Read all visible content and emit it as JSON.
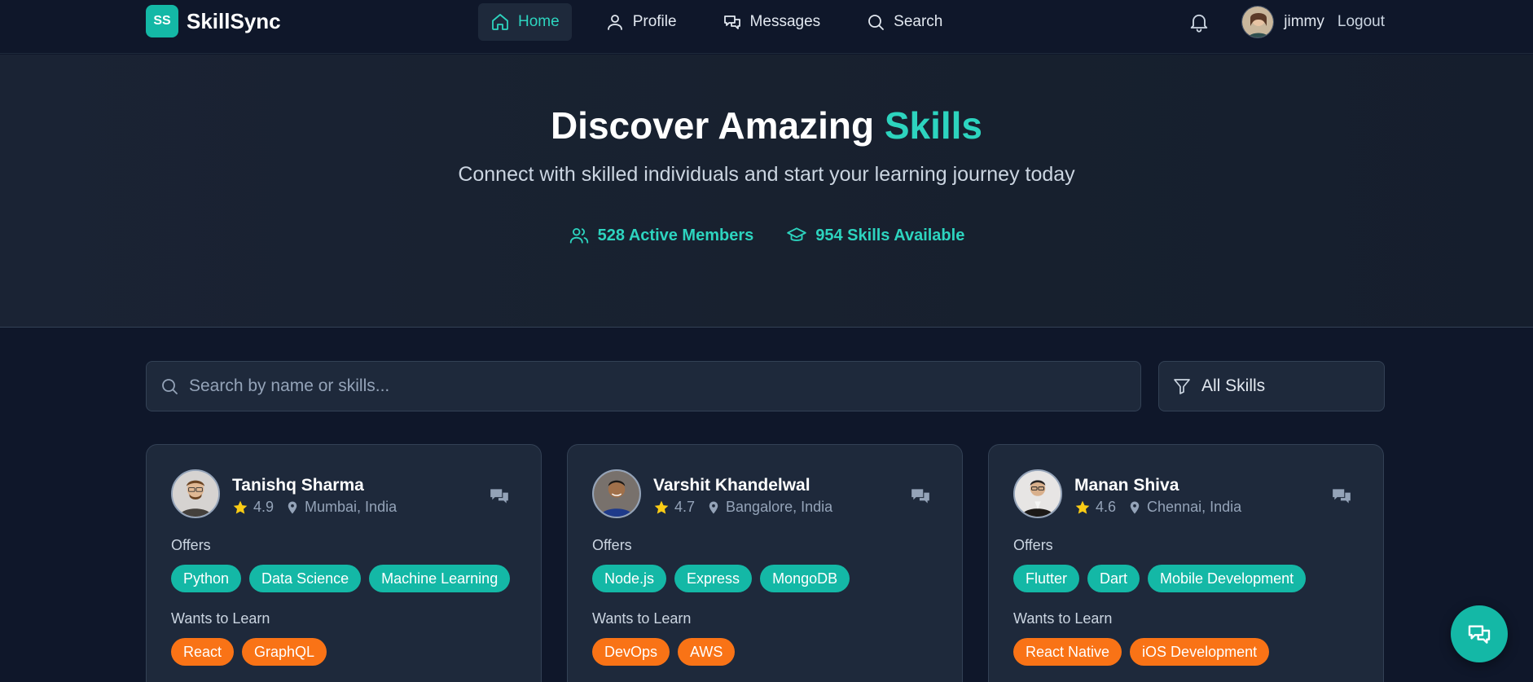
{
  "brand": {
    "logo": "SS",
    "name": "SkillSync"
  },
  "nav": [
    {
      "label": "Home",
      "icon": "home-icon",
      "active": true
    },
    {
      "label": "Profile",
      "icon": "user-icon",
      "active": false
    },
    {
      "label": "Messages",
      "icon": "messages-icon",
      "active": false
    },
    {
      "label": "Search",
      "icon": "search-icon",
      "active": false
    }
  ],
  "user": {
    "name": "jimmy",
    "logout": "Logout"
  },
  "hero": {
    "title_main": "Discover Amazing ",
    "title_accent": "Skills",
    "subtitle": "Connect with skilled individuals and start your learning journey today",
    "stats": [
      {
        "icon": "users-icon",
        "text": "528 Active Members"
      },
      {
        "icon": "graduation-cap-icon",
        "text": "954 Skills Available"
      }
    ]
  },
  "search": {
    "placeholder": "Search by name or skills...",
    "filter_label": "All Skills"
  },
  "cards": [
    {
      "name": "Tanishq Sharma",
      "rating": "4.9",
      "location": "Mumbai, India",
      "offers_label": "Offers",
      "offers": [
        "Python",
        "Data Science",
        "Machine Learning"
      ],
      "learn_label": "Wants to Learn",
      "learn": [
        "React",
        "GraphQL"
      ]
    },
    {
      "name": "Varshit Khandelwal",
      "rating": "4.7",
      "location": "Bangalore, India",
      "offers_label": "Offers",
      "offers": [
        "Node.js",
        "Express",
        "MongoDB"
      ],
      "learn_label": "Wants to Learn",
      "learn": [
        "DevOps",
        "AWS"
      ]
    },
    {
      "name": "Manan Shiva",
      "rating": "4.6",
      "location": "Chennai, India",
      "offers_label": "Offers",
      "offers": [
        "Flutter",
        "Dart",
        "Mobile Development"
      ],
      "learn_label": "Wants to Learn",
      "learn": [
        "React Native",
        "iOS Development"
      ]
    }
  ],
  "colors": {
    "accent": "#14b8a6",
    "accent_text": "#2dd4bf",
    "learn": "#f97316",
    "background": "#0f172a",
    "card": "#1e293b"
  }
}
